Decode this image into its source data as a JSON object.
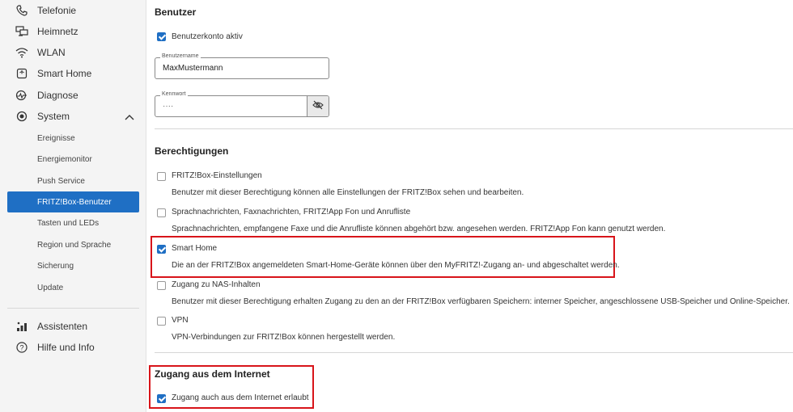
{
  "sidebar": {
    "items_top": [
      {
        "label": "Telefonie",
        "icon": "phone-icon"
      },
      {
        "label": "Heimnetz",
        "icon": "network-icon"
      },
      {
        "label": "WLAN",
        "icon": "wifi-icon"
      },
      {
        "label": "Smart Home",
        "icon": "smart-home-icon"
      },
      {
        "label": "Diagnose",
        "icon": "diagnose-icon"
      },
      {
        "label": "System",
        "icon": "system-icon"
      }
    ],
    "sub_items": [
      "Ereignisse",
      "Energiemonitor",
      "Push Service",
      "FRITZ!Box-Benutzer",
      "Tasten und LEDs",
      "Region und Sprache",
      "Sicherung",
      "Update"
    ],
    "active_sub": "FRITZ!Box-Benutzer",
    "items_bottom": [
      {
        "label": "Assistenten",
        "icon": "wizard-icon"
      },
      {
        "label": "Hilfe und Info",
        "icon": "help-icon"
      }
    ]
  },
  "benutzer": {
    "heading": "Benutzer",
    "account_active_label": "Benutzerkonto aktiv",
    "account_active_checked": true,
    "username_label": "Benutzername",
    "username_value": "MaxMustermann",
    "password_label": "Kennwort",
    "password_value": "····"
  },
  "berechtigungen": {
    "heading": "Berechtigungen",
    "items": [
      {
        "label": "FRITZ!Box-Einstellungen",
        "checked": false,
        "desc": "Benutzer mit dieser Berechtigung können alle Einstellungen der FRITZ!Box sehen und bearbeiten."
      },
      {
        "label": "Sprachnachrichten, Faxnachrichten, FRITZ!App Fon und Anrufliste",
        "checked": false,
        "desc": "Sprachnachrichten, empfangene Faxe und die Anrufliste können abgehört bzw. angesehen werden. FRITZ!App Fon kann genutzt werden."
      },
      {
        "label": "Smart Home",
        "checked": true,
        "desc": "Die an der FRITZ!Box angemeldeten Smart-Home-Geräte können über den MyFRITZ!-Zugang an- und abgeschaltet werden."
      },
      {
        "label": "Zugang zu NAS-Inhalten",
        "checked": false,
        "desc": "Benutzer mit dieser Berechtigung erhalten Zugang zu den an der FRITZ!Box verfügbaren Speichern: interner Speicher, angeschlossene USB-Speicher und Online-Speicher."
      },
      {
        "label": "VPN",
        "checked": false,
        "desc": "VPN-Verbindungen zur FRITZ!Box können hergestellt werden."
      }
    ]
  },
  "internet": {
    "heading": "Zugang aus dem Internet",
    "allow_label": "Zugang auch aus dem Internet erlaubt",
    "allow_checked": true
  },
  "colors": {
    "accent": "#1f6fc4",
    "highlight": "#d8141a"
  }
}
